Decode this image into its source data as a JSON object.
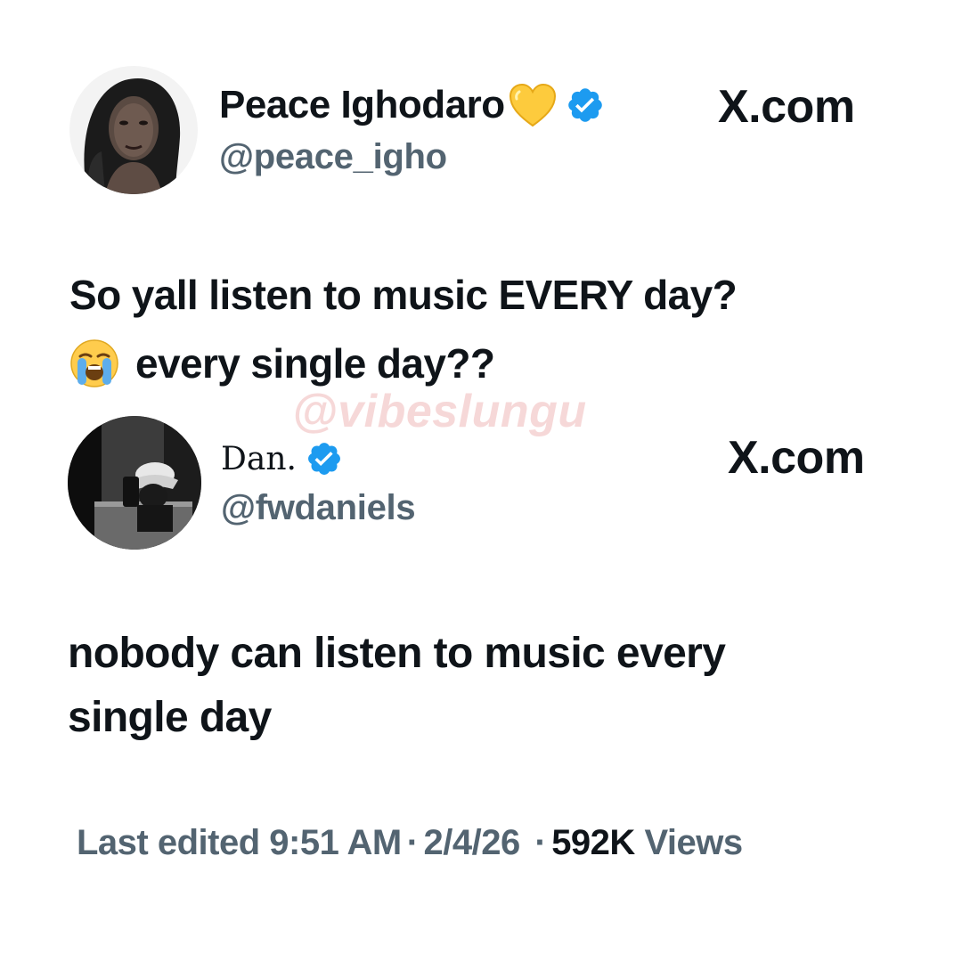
{
  "tweets": [
    {
      "avatar_icon": "profile-photo-woman",
      "display_name": "Peace Ighodaro",
      "name_emoji": "yellow-heart-icon",
      "verified_icon": "verified-badge-icon",
      "handle": "@peace_igho",
      "source": "X.com",
      "text_lines": [
        "So yall listen to music EVERY day?",
        "every single day??"
      ],
      "text_emoji": "loudly-crying-face-icon"
    },
    {
      "avatar_icon": "profile-photo-bucket-hat",
      "display_name": "Dan.",
      "verified_icon": "verified-badge-icon",
      "handle": "@fwdaniels",
      "source": "X.com",
      "text_lines": [
        "nobody can listen to music every",
        "single day"
      ]
    }
  ],
  "watermark": "@vibeslungu",
  "meta": {
    "last_edited_label": "Last edited",
    "time": "9:51 AM",
    "date": "2/4/26",
    "separator": "·",
    "views_count": "592K",
    "views_label": "Views"
  },
  "colors": {
    "text": "#0f1419",
    "secondary": "#536471",
    "verified_blue": "#1d9bf0",
    "watermark_pink": "#f4cccc"
  }
}
